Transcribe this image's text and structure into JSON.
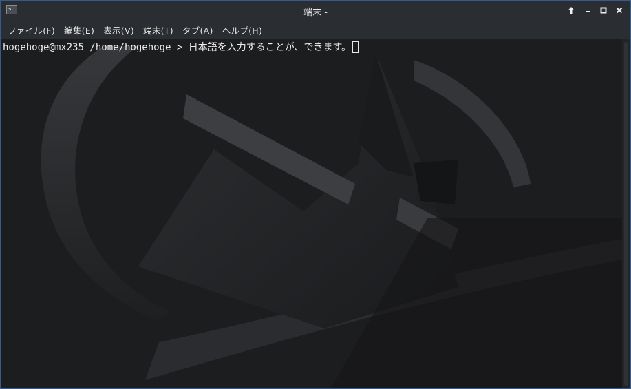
{
  "window": {
    "title": "端末 -",
    "app_icon_glyph": ">_",
    "buttons": {
      "keep_above": "↑",
      "minimize": "–",
      "maximize": "□",
      "close": "×"
    }
  },
  "menubar": {
    "items": [
      {
        "label": "ファイル(F)"
      },
      {
        "label": "編集(E)"
      },
      {
        "label": "表示(V)"
      },
      {
        "label": "端末(T)"
      },
      {
        "label": "タブ(A)"
      },
      {
        "label": "ヘルプ(H)"
      }
    ]
  },
  "terminal": {
    "prompt": "hogehoge@mx235 /home/hogehoge > ",
    "input": "日本語を入力することが、できます。"
  },
  "colors": {
    "titlebar": "#2a2d31",
    "terminal_bg": "#1c1d1f",
    "text": "#ececec",
    "border": "#3a5a8a"
  }
}
